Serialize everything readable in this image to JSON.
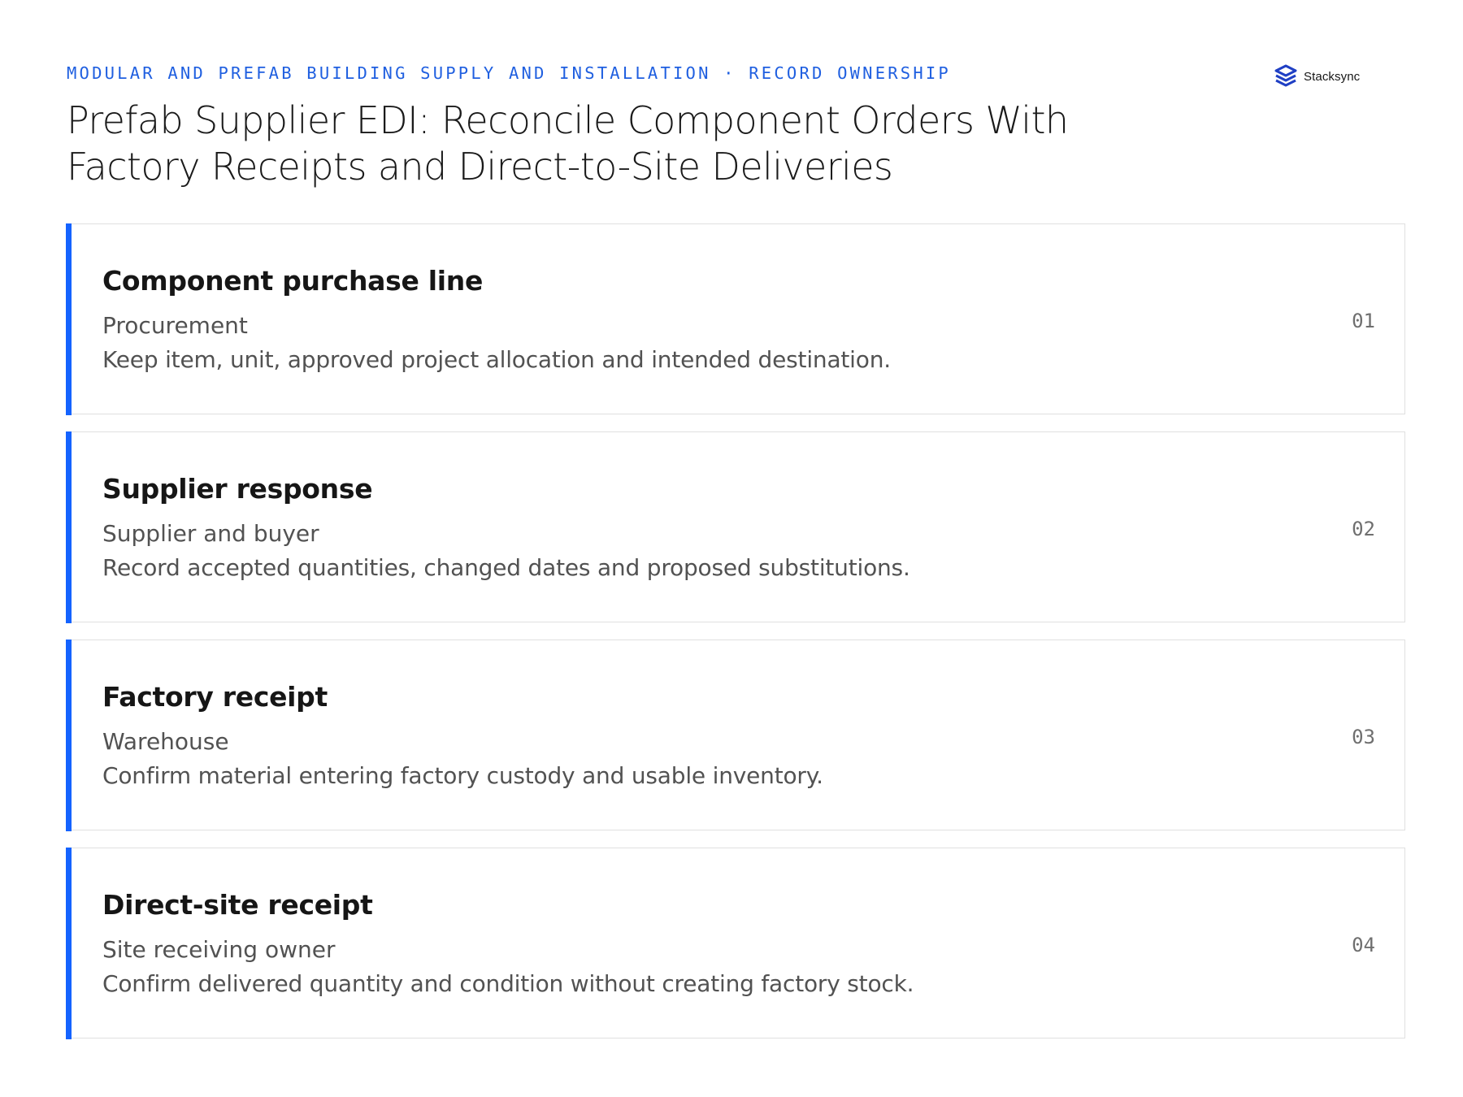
{
  "header": {
    "eyebrow": "MODULAR AND PREFAB BUILDING SUPPLY AND INSTALLATION · RECORD OWNERSHIP",
    "title": "Prefab Supplier EDI: Reconcile Component Orders With Factory Receipts and Direct-to-Site Deliveries"
  },
  "brand": {
    "name": "Stacksync",
    "icon": "stacksync-logo-icon",
    "color": "#1f3fc4"
  },
  "accent_color": "#1463ff",
  "cards": [
    {
      "title": "Component purchase line",
      "owner": "Procurement",
      "description": "Keep item, unit, approved project allocation and intended destination.",
      "number": "01"
    },
    {
      "title": "Supplier response",
      "owner": "Supplier and buyer",
      "description": "Record accepted quantities, changed dates and proposed substitutions.",
      "number": "02"
    },
    {
      "title": "Factory receipt",
      "owner": "Warehouse",
      "description": "Confirm material entering factory custody and usable inventory.",
      "number": "03"
    },
    {
      "title": "Direct-site receipt",
      "owner": "Site receiving owner",
      "description": "Confirm delivered quantity and condition without creating factory stock.",
      "number": "04"
    }
  ]
}
